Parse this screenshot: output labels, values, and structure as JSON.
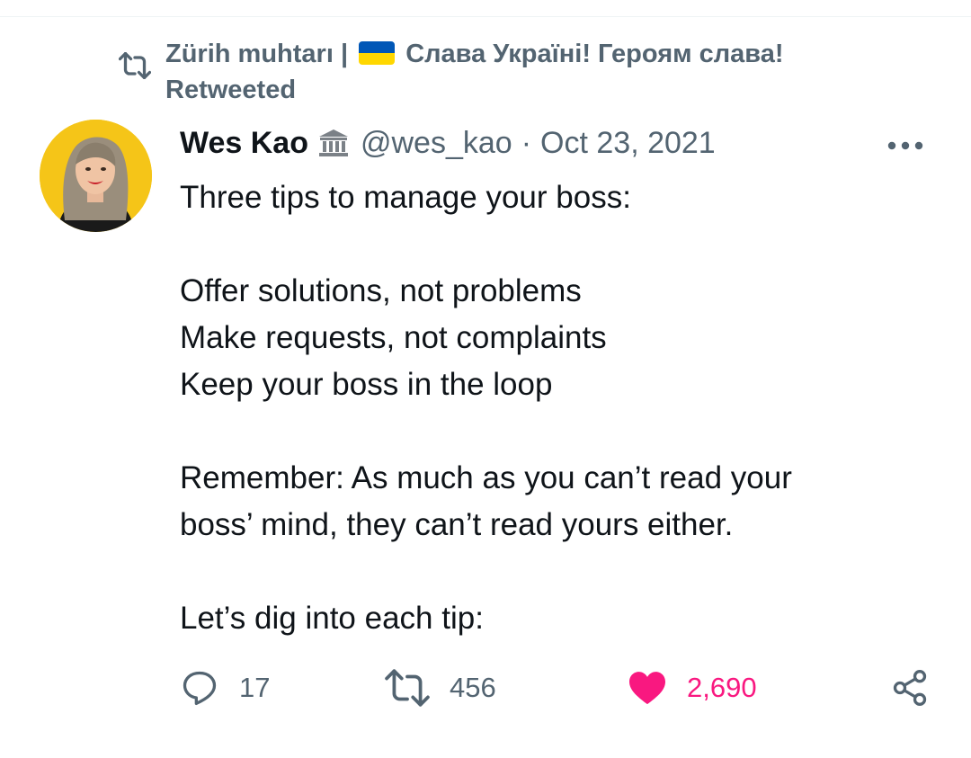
{
  "retweet": {
    "user_prefix": "Zürih muhtarı |",
    "user_suffix": "Слава Україні! Героям слава!",
    "label": "Retweeted"
  },
  "author": {
    "name": "Wes Kao",
    "handle": "@wes_kao",
    "separator": "·",
    "date": "Oct 23, 2021"
  },
  "tweet": {
    "line1": "Three tips to manage your boss:",
    "line2": "Offer solutions, not problems",
    "line3": "Make requests, not complaints",
    "line4": "Keep your boss in the loop",
    "line5": "Remember: As much as you can’t read your",
    "line6": "boss’ mind, they can’t read yours either.",
    "line7": "Let’s dig into each tip:"
  },
  "actions": {
    "replies": "17",
    "retweets": "456",
    "likes": "2,690"
  },
  "colors": {
    "text": "#0f1419",
    "secondary": "#536471",
    "like": "#f91880",
    "flag_blue": "#0057b7",
    "flag_yellow": "#ffd700"
  }
}
